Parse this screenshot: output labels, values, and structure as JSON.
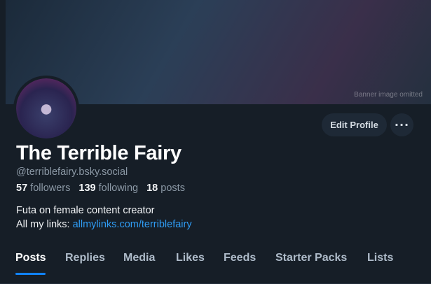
{
  "banner": {
    "note": "Banner image omitted"
  },
  "profile": {
    "display_name": "The Terrible Fairy",
    "handle": "@terriblefairy.bsky.social",
    "followers_count": "57",
    "followers_label": "followers",
    "following_count": "139",
    "following_label": "following",
    "posts_count": "18",
    "posts_label": "posts",
    "bio_line1": "Futa on female content creator",
    "bio_line2_prefix": "All my links: ",
    "bio_link": "allmylinks.com/terriblefairy"
  },
  "actions": {
    "edit_profile_label": "Edit Profile",
    "more_label": "···"
  },
  "tabs": [
    {
      "label": "Posts",
      "active": true
    },
    {
      "label": "Replies"
    },
    {
      "label": "Media"
    },
    {
      "label": "Likes"
    },
    {
      "label": "Feeds"
    },
    {
      "label": "Starter Packs"
    },
    {
      "label": "Lists"
    }
  ],
  "colors": {
    "background": "#161e27",
    "accent": "#1083fe",
    "link": "#2f9cf4",
    "muted": "#8b98a5"
  }
}
